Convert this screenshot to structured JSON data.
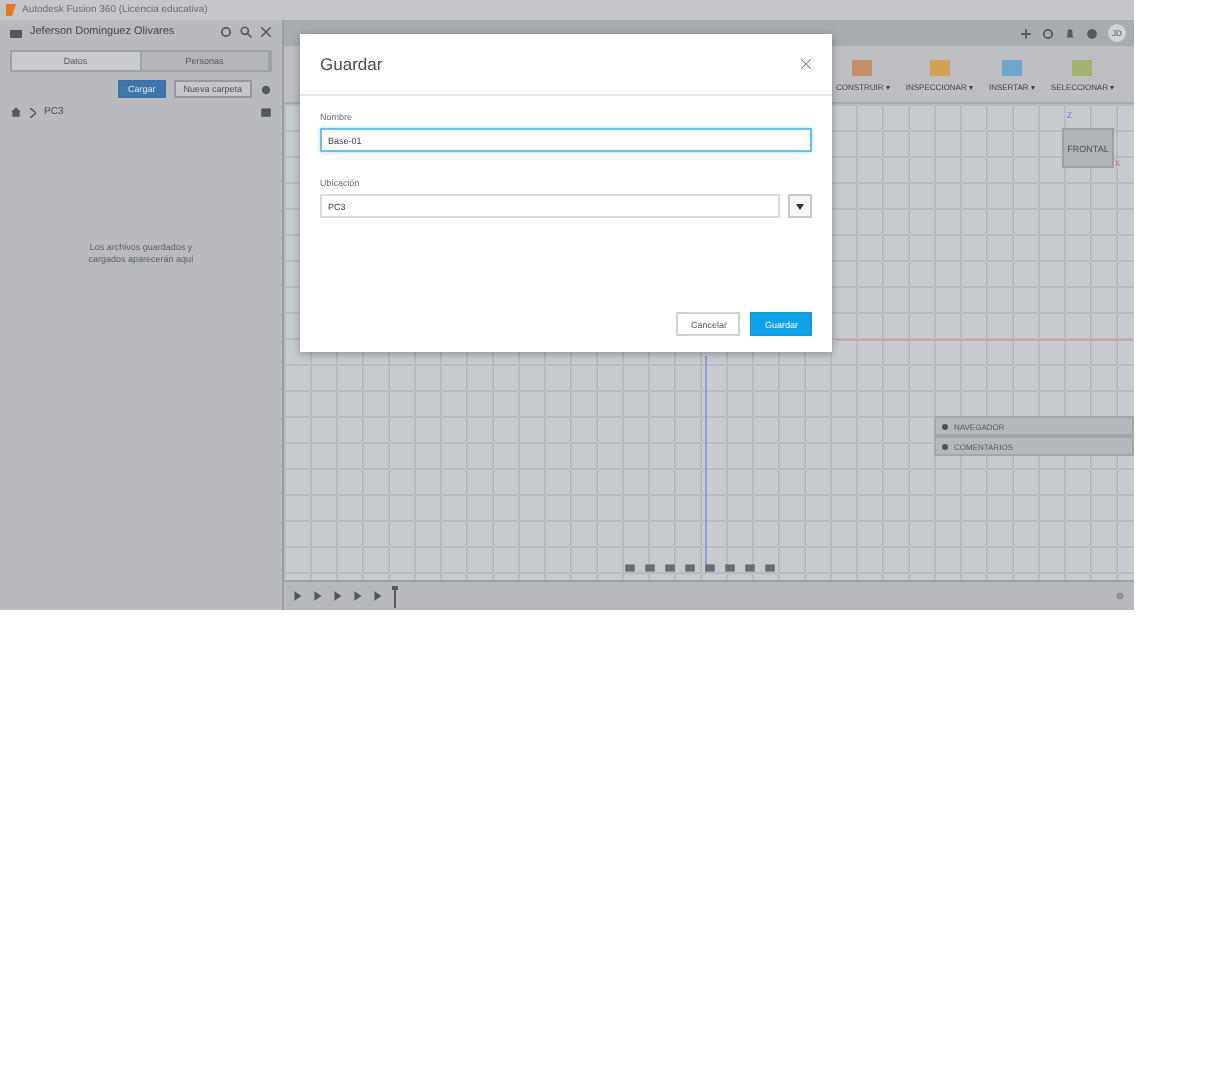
{
  "window": {
    "title": "Autodesk Fusion 360 (Licencia educativa)"
  },
  "data_panel": {
    "user": "Jeferson Dominguez Olivares",
    "tabs": [
      {
        "label": "Datos",
        "selected": true
      },
      {
        "label": "Personas",
        "selected": false
      }
    ],
    "upload_button": "Cargar",
    "new_folder_button": "Nueva carpeta",
    "breadcrumb": "PC3",
    "empty_message": "Los archivos guardados y cargados aparecerán aquí"
  },
  "account": {
    "initials": "JD"
  },
  "toolbar": {
    "groups": [
      {
        "label": "CONSTRUIR ▾"
      },
      {
        "label": "INSPECCIONAR ▾"
      },
      {
        "label": "INSERTAR ▾"
      },
      {
        "label": "SELECCIONAR ▾"
      }
    ]
  },
  "viewcube": {
    "face": "FRONTAL",
    "z_axis": "Z",
    "x_axis": "X"
  },
  "browser_panels": [
    {
      "label": "NAVEGADOR"
    },
    {
      "label": "COMENTARIOS"
    }
  ],
  "dialog": {
    "title": "Guardar",
    "name_label": "Nombre",
    "name_value": "Base-01",
    "location_label": "Ubicación",
    "location_value": "PC3",
    "cancel": "Cancelar",
    "save": "Guardar"
  }
}
